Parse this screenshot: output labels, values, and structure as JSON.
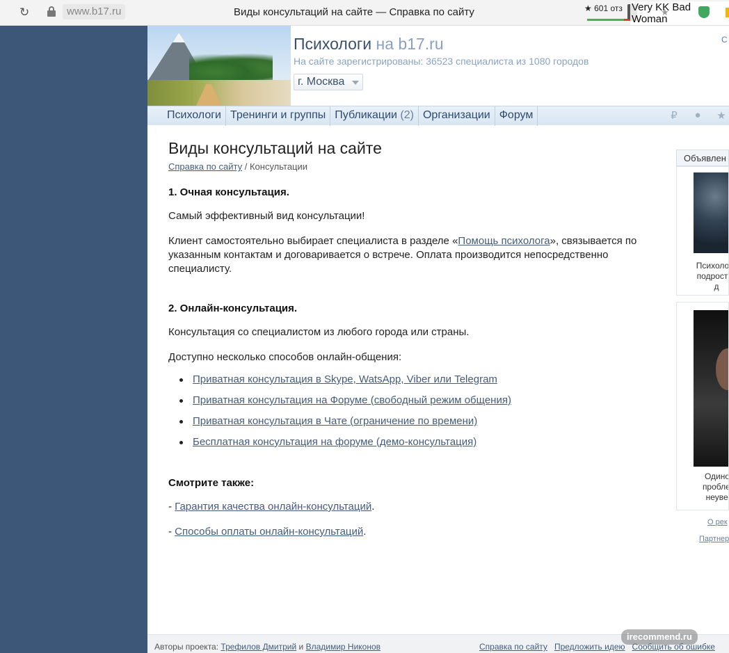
{
  "browser": {
    "url": "www.b17.ru",
    "tab_title": "Виды консультаций на сайте — Справка по сайту",
    "rating_text": "★ 601 отз",
    "overlay_text": "Very KK Bad Woman",
    "colors": {
      "rating_good": "#4caf50",
      "rating_bad": "#e53935"
    }
  },
  "header": {
    "site_title": "Психологи",
    "site_title_suffix": "на b17.ru",
    "subtitle": "На сайте зарегистрированы: 36523 специалиста из 1080 городов",
    "city": "г. Москва",
    "top_right": "С"
  },
  "nav": {
    "items": [
      {
        "label": "Психологи"
      },
      {
        "label": "Тренинги и группы"
      },
      {
        "label": "Публикации",
        "count": "(2)"
      },
      {
        "label": "Организации"
      },
      {
        "label": "Форум"
      }
    ],
    "icons": [
      "ruble-icon",
      "chat-icon",
      "star-icon"
    ]
  },
  "main": {
    "title": "Виды консультаций на сайте",
    "breadcrumb": {
      "link": "Справка по сайту",
      "separator": "/",
      "current": "Консультации"
    },
    "section1": {
      "heading": "1. Очная консультация.",
      "p1": "Самый эффективный вид консультации!",
      "p2_before": "Клиент самостоятельно выбирает специалиста в разделе «",
      "p2_link": "Помощь психолога",
      "p2_after": "», связывается по указанным контактам и договаривается о встрече. Оплата производится непосредственно специалисту."
    },
    "section2": {
      "heading": "2. Онлайн-консультация.",
      "p1": "Консультация со специалистом из любого города или страны.",
      "p2": "Доступно несколько способов онлайн-общения:",
      "options": [
        "Приватная консультация в Skype, WatsApp, Viber или Telegram",
        "Приватная консультация на Форуме (свободный режим общения)",
        "Приватная консультация в Чате (ограничение по времени)",
        "Бесплатная консультация на форуме (демо-консультация)"
      ]
    },
    "see_also": {
      "heading": "Смотрите также:",
      "dash": "-",
      "links": [
        "Гарантия качества онлайн-консультаций",
        "Способы оплаты онлайн-консультаций"
      ],
      "period": "."
    }
  },
  "sidebar": {
    "header": "Объявлен",
    "ads": [
      {
        "lines": [
          "Психологи",
          "подростко",
          "д"
        ]
      },
      {
        "lines": [
          "Одиноч",
          "проблем",
          "неувер"
        ]
      }
    ],
    "link_about": "О рек",
    "link_partner": "Партнер"
  },
  "footer": {
    "authors_label": "Авторы проекта:",
    "author1": "Трефилов Дмитрий",
    "and": "и",
    "author2": "Владимир Никонов",
    "help_link": "Справка по сайту",
    "suggest_link": "Предложить идею",
    "report_link": "Сообщить об ошибке"
  },
  "watermark": "irecommend.ru"
}
